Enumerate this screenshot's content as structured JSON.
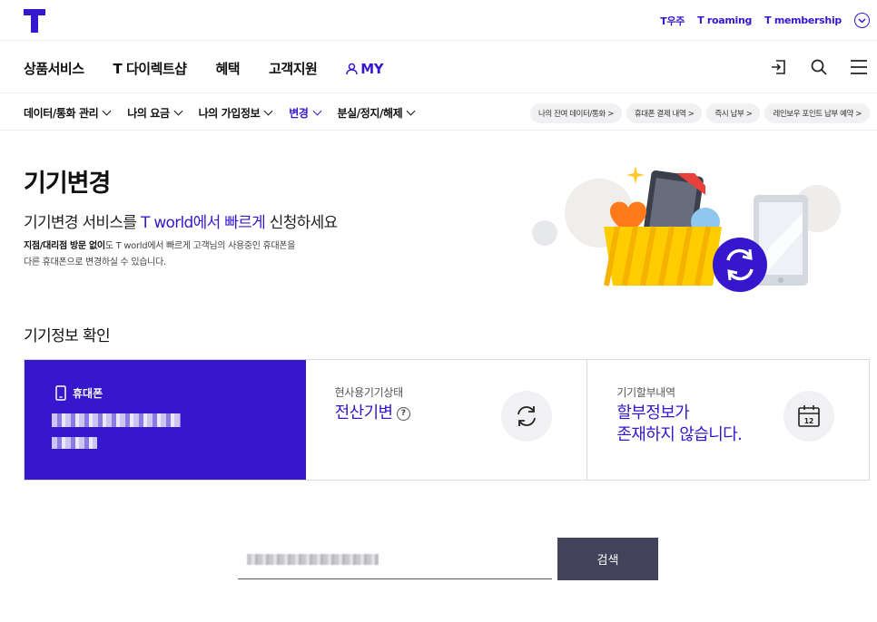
{
  "brand": {
    "accent": "#3617ce",
    "button_dark": "#42425a"
  },
  "utility_links": [
    "T우주",
    "T roaming",
    "T membership"
  ],
  "gnb": {
    "items": [
      "상품서비스",
      "T 다이렉트샵",
      "혜택",
      "고객지원"
    ],
    "my_label": "MY",
    "icons": [
      "logout-icon",
      "search-icon",
      "menu-icon"
    ]
  },
  "subnav": {
    "items": [
      {
        "label": "데이터/통화 관리",
        "active": false
      },
      {
        "label": "나의 요금",
        "active": false
      },
      {
        "label": "나의 가입정보",
        "active": false
      },
      {
        "label": "변경",
        "active": true
      },
      {
        "label": "분실/정지/해제",
        "active": false
      }
    ],
    "quick_links": [
      "나의 잔여 데이터/통화 >",
      "휴대폰 결제 내역 >",
      "즉시 납부 >",
      "레인보우 포인트 납부 예약 >"
    ]
  },
  "hero": {
    "title": "기기변경",
    "subtitle_pre": "기기변경 서비스를 ",
    "subtitle_highlight": "T world에서 빠르게",
    "subtitle_post": " 신청하세요",
    "desc_bold": "지점/대리점 방문 없이",
    "desc_line1_rest": "도 T world에서 빠르게 고객님의 사용중인 휴대폰을",
    "desc_line2": "다른 휴대폰으로 변경하실 수 있습니다."
  },
  "device_info": {
    "section_title": "기기정보 확인",
    "phone_card": {
      "label": "휴대폰"
    },
    "status_card": {
      "label": "현사용기기상태",
      "value": "전산기변",
      "help": "?"
    },
    "installment_card": {
      "label": "기기할부내역",
      "value_line1": "할부정보가",
      "value_line2": "존재하지 않습니다.",
      "calendar_day": "12"
    }
  },
  "search": {
    "button_label": "검색"
  }
}
